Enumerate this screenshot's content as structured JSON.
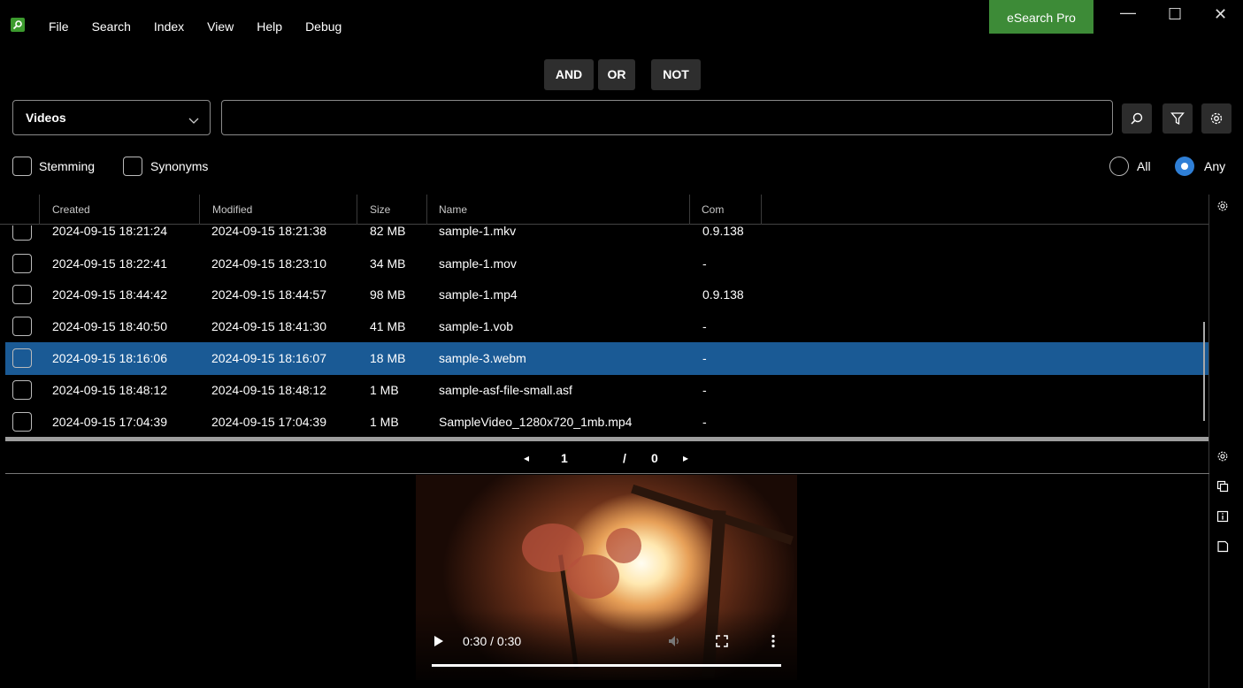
{
  "menu": {
    "items": [
      "File",
      "Search",
      "Index",
      "View",
      "Help",
      "Debug"
    ]
  },
  "pro_button": "eSearch Pro",
  "window_controls": {
    "minimize": "—",
    "maximize": "☐",
    "close": "✕"
  },
  "boolean_ops": {
    "and": "AND",
    "or": "OR",
    "not": "NOT"
  },
  "search": {
    "type": "Videos",
    "query": "",
    "placeholder": ""
  },
  "options": {
    "stemming": "Stemming",
    "synonyms": "Synonyms",
    "all": "All",
    "any": "Any",
    "match_mode": "Any"
  },
  "table": {
    "columns": [
      "Created",
      "Modified",
      "Size",
      "Name",
      "Com"
    ],
    "rows": [
      {
        "created": "2024-09-15 18:21:24",
        "modified": "2024-09-15 18:21:38",
        "size": "82 MB",
        "name": "sample-1.mkv",
        "com": "0.9.138"
      },
      {
        "created": "2024-09-15 18:22:41",
        "modified": "2024-09-15 18:23:10",
        "size": "34 MB",
        "name": "sample-1.mov",
        "com": "-"
      },
      {
        "created": "2024-09-15 18:44:42",
        "modified": "2024-09-15 18:44:57",
        "size": "98 MB",
        "name": "sample-1.mp4",
        "com": "0.9.138"
      },
      {
        "created": "2024-09-15 18:40:50",
        "modified": "2024-09-15 18:41:30",
        "size": "41 MB",
        "name": "sample-1.vob",
        "com": "-"
      },
      {
        "created": "2024-09-15 18:16:06",
        "modified": "2024-09-15 18:16:07",
        "size": "18 MB",
        "name": "sample-3.webm",
        "com": "-"
      },
      {
        "created": "2024-09-15 18:48:12",
        "modified": "2024-09-15 18:48:12",
        "size": "1 MB",
        "name": "sample-asf-file-small.asf",
        "com": "-"
      },
      {
        "created": "2024-09-15 17:04:39",
        "modified": "2024-09-15 17:04:39",
        "size": "1 MB",
        "name": "SampleVideo_1280x720_1mb.mp4",
        "com": "-"
      }
    ],
    "selected_row": 4
  },
  "pager": {
    "prev": "◂",
    "page": "1",
    "separator": "/",
    "total": "0",
    "next": "▸"
  },
  "video": {
    "time": "0:30 / 0:30",
    "progress": 1.0
  },
  "colors": {
    "accent_green": "#3d8b37",
    "selection_blue": "#1a5a95",
    "radio_blue": "#2f7fd6"
  },
  "icons": [
    "app-logo-icon",
    "search-icon",
    "filter-icon",
    "settings-icon",
    "copy-icon",
    "info-icon",
    "note-icon",
    "play-icon",
    "volume-icon",
    "fullscreen-icon",
    "more-icon"
  ]
}
